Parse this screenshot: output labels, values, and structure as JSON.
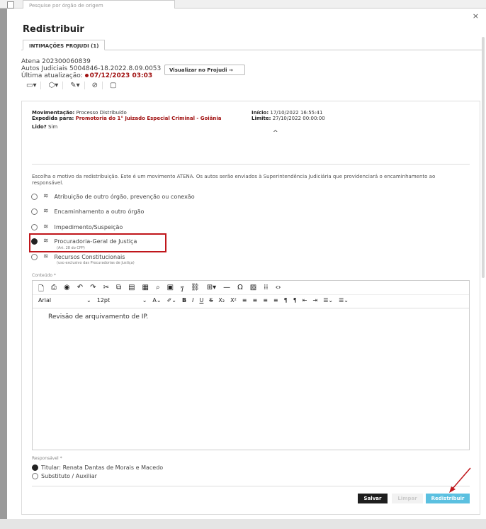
{
  "topbar": {
    "search_placeholder": "Pesquise por órgão de origem"
  },
  "modal": {
    "title": "Redistribuir",
    "close": "×",
    "tab_label": "INTIMAÇÕES PROJUDI (1)",
    "info": {
      "line1": "Atena 202300060839",
      "line2": "Autos Judiciais 5004846-18.2022.8.09.0053",
      "line3_label": "Última atualização:",
      "line3_value": "07/12/2023 03:03"
    },
    "view_button": "Visualizar no Projudi →",
    "icons": [
      "calendar-icon",
      "tag-icon",
      "edit-icon",
      "ban-icon",
      "comment-icon"
    ]
  },
  "movement": {
    "mov_label": "Movimentação:",
    "mov_value": "Processo Distribuído",
    "exp_label": "Expedida para:",
    "exp_value": "Promotoria do 1° Juizado Especial Criminal - Goiânia",
    "lido_label": "Lido?",
    "lido_value": "Sim",
    "inicio_label": "Início:",
    "inicio_value": "17/10/2022 16:55:41",
    "limite_label": "Limite:",
    "limite_value": "27/10/2022 00:00:00",
    "toggle": "^"
  },
  "redistribution": {
    "description": "Escolha o motivo da redistribuição. Este é um movimento ATENA. Os autos serão enviados à Superintendência Judiciária que providenciará o encaminhamento ao responsável.",
    "options": [
      {
        "label": "Atribuição de outro órgão, prevenção ou conexão",
        "sub": ""
      },
      {
        "label": "Encaminhamento a outro órgão",
        "sub": ""
      },
      {
        "label": "Impedimento/Suspeição",
        "sub": ""
      },
      {
        "label": "Procuradoria-Geral de Justiça",
        "sub": "(Art. 28 do CPP)"
      },
      {
        "label": "Recursos Constitucionais",
        "sub": "(uso exclusivo das Procuradorias de Justiça)"
      }
    ],
    "selected_index": 3
  },
  "editor": {
    "label": "Conteúdo *",
    "font": "Arial",
    "size": "12pt",
    "text": "Revisão de arquivamento de IP."
  },
  "responsible": {
    "label": "Responsável *",
    "options": [
      "Titular: Renata Dantas de Morais e Macedo",
      "Substituto / Auxiliar"
    ],
    "selected_index": 0
  },
  "actions": {
    "save": "Salvar",
    "clear": "Limpar",
    "redistribute": "Redistribuir"
  },
  "colors": {
    "accent_red": "#a01010",
    "primary_button": "#5bc0e0",
    "highlight": "#c0161b"
  }
}
